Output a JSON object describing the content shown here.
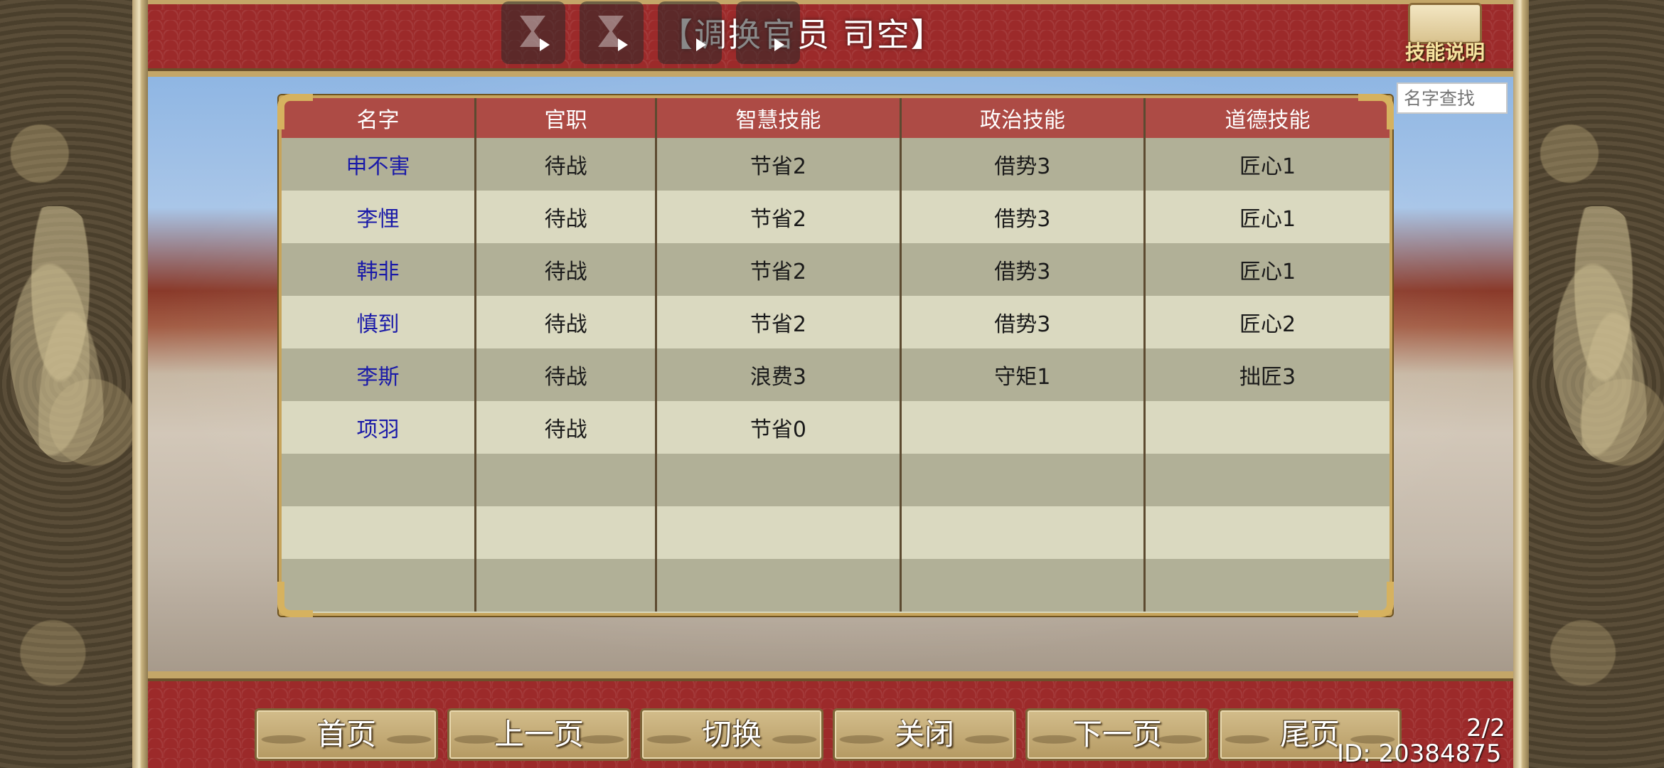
{
  "header": {
    "title": "【调换官员 司空】",
    "skill_help_label": "技能说明"
  },
  "search": {
    "placeholder": "名字查找"
  },
  "table": {
    "columns": [
      "名字",
      "官职",
      "智慧技能",
      "政治技能",
      "道德技能"
    ],
    "rows": [
      [
        "申不害",
        "待战",
        "节省2",
        "借势3",
        "匠心1"
      ],
      [
        "李悝",
        "待战",
        "节省2",
        "借势3",
        "匠心1"
      ],
      [
        "韩非",
        "待战",
        "节省2",
        "借势3",
        "匠心1"
      ],
      [
        "慎到",
        "待战",
        "节省2",
        "借势3",
        "匠心2"
      ],
      [
        "李斯",
        "待战",
        "浪费3",
        "守矩1",
        "拙匠3"
      ],
      [
        "项羽",
        "待战",
        "节省0",
        "",
        ""
      ],
      [
        "",
        "",
        "",
        "",
        ""
      ],
      [
        "",
        "",
        "",
        "",
        ""
      ],
      [
        "",
        "",
        "",
        "",
        ""
      ]
    ]
  },
  "nav": {
    "first": "首页",
    "prev": "上一页",
    "switch": "切换",
    "close": "关闭",
    "next": "下一页",
    "last": "尾页"
  },
  "pagination": "2/2",
  "user_id": "ID: 20384875",
  "colors": {
    "header_bg": "#ad4b45",
    "row_dark": "#b1b097",
    "row_light": "#dad9c0",
    "name_text": "#1a1aa8",
    "banner_red": "#9c2a2a"
  }
}
